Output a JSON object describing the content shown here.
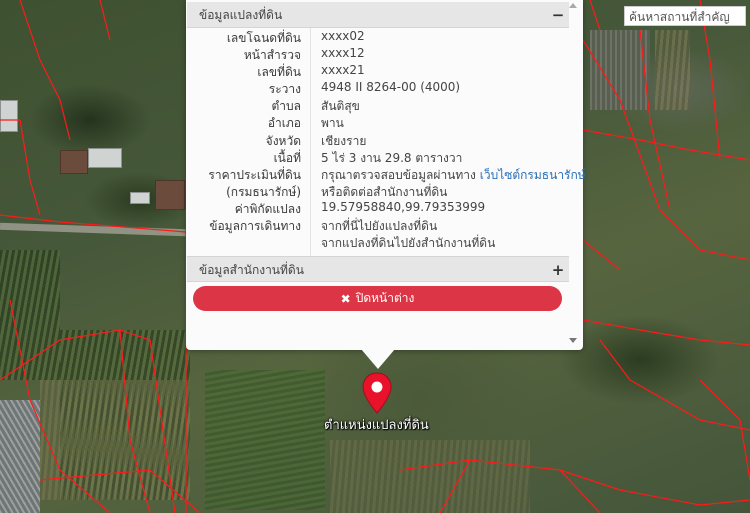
{
  "search": {
    "placeholder": "ค้นหาสถานที่สำคัญ"
  },
  "popup": {
    "land_info_title": "ข้อมูลแปลงที่ดิน",
    "land_info_toggle": "−",
    "office_info_title": "ข้อมูลสำนักงานที่ดิน",
    "office_info_toggle": "+",
    "rows": [
      {
        "label": "เลขโฉนดที่ดิน",
        "value": "xxxx02"
      },
      {
        "label": "หน้าสำรวจ",
        "value": "xxxx12"
      },
      {
        "label": "เลขที่ดิน",
        "value": "xxxx21"
      },
      {
        "label": "ระวาง",
        "value": "4948 II 8264-00 (4000)"
      },
      {
        "label": "ตำบล",
        "value": "สันติสุข"
      },
      {
        "label": "อำเภอ",
        "value": "พาน"
      },
      {
        "label": "จังหวัด",
        "value": "เชียงราย"
      },
      {
        "label": "เนื้อที่",
        "value": "5 ไร่ 3 งาน 29.8 ตารางวา"
      }
    ],
    "price": {
      "label_line1": "ราคาประเมินที่ดิน",
      "label_line2": "(กรมธนารักษ์)",
      "value_text": "กรุณาตรวจสอบข้อมูลผ่านทาง",
      "value_link": "เว็บไซต์กรมธนารักษ์",
      "value_line2": "หรือติดต่อสำนักงานที่ดิน"
    },
    "coords": {
      "label": "ค่าพิกัดแปลง",
      "value": "19.57958840,99.79353999"
    },
    "directions": {
      "label": "ข้อมูลการเดินทาง",
      "link1": "จากที่นี่ไปยังแปลงที่ดิน",
      "link2": "จากแปลงที่ดินไปยังสำนักงานที่ดิน"
    },
    "close_label": "ปิดหน้าต่าง"
  },
  "marker": {
    "label": "ตำแหน่งแปลงที่ดิน",
    "color": "#e8132b"
  },
  "colors": {
    "close_button": "#dc3545",
    "link": "#2a6fb8",
    "parcel_border": "#ff1a1a"
  }
}
